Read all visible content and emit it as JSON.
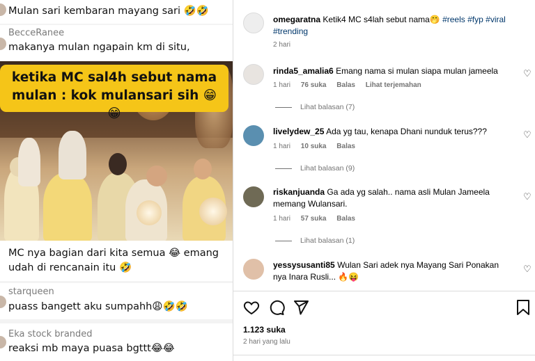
{
  "left": {
    "top_comment": "Mulan sari kembaran mayang sari 🤣🤣",
    "comment2": {
      "user": "BecceRanee",
      "text": "makanya mulan ngapain km di situ,"
    },
    "video_caption_line1": "ketika MC sal4h sebut nama",
    "video_caption_line2": "mulan : kok mulansari sih 😁😁",
    "comment3": {
      "text_line1": "MC nya bagian dari kita semua 😂 emang",
      "text_line2": "udah di rencanain itu 🤣"
    },
    "comment4": {
      "user": "starqueen",
      "text": "puass bangett aku sumpahh😩🤣🤣"
    },
    "comment5": {
      "user": "Eka stock branded",
      "text": "reaksi mb maya puasa bgttt😂😂"
    }
  },
  "post": {
    "author": "omegaratna",
    "caption": "Ketik4 MC s4lah sebut nama🤭",
    "tags": [
      "#reels",
      "#fyp",
      "#viral",
      "#trending"
    ],
    "time": "2 hari"
  },
  "comments": [
    {
      "user": "rinda5_amalia6",
      "text": "Emang nama si mulan siapa mulan jameela",
      "time": "1 hari",
      "likes": "76 suka",
      "reply": "Balas",
      "translate": "Lihat terjemahan",
      "replies": "Lihat balasan (7)",
      "avatar_color": "#e8e4e0"
    },
    {
      "user": "livelydew_25",
      "text": "Ada yg tau, kenapa Dhani nunduk terus???",
      "time": "1 hari",
      "likes": "10 suka",
      "reply": "Balas",
      "replies": "Lihat balasan (9)",
      "avatar_color": "#5a8fb0"
    },
    {
      "user": "riskanjuanda",
      "text": "Ga ada yg salah.. nama asli Mulan Jameela memang Wulansari.",
      "time": "1 hari",
      "likes": "57 suka",
      "reply": "Balas",
      "replies": "Lihat balasan (1)",
      "avatar_color": "#6f6a55"
    },
    {
      "user": "yessysusanti85",
      "text": "Wulan Sari adek nya Mayang Sari Ponakan nya Inara Rusli... 🔥😝",
      "avatar_color": "#e0c0a8"
    }
  ],
  "footer": {
    "likes": "1.123 suka",
    "date": "2 hari yang lalu"
  },
  "icons": [
    "heart-icon",
    "comment-icon",
    "share-icon",
    "bookmark-icon"
  ]
}
